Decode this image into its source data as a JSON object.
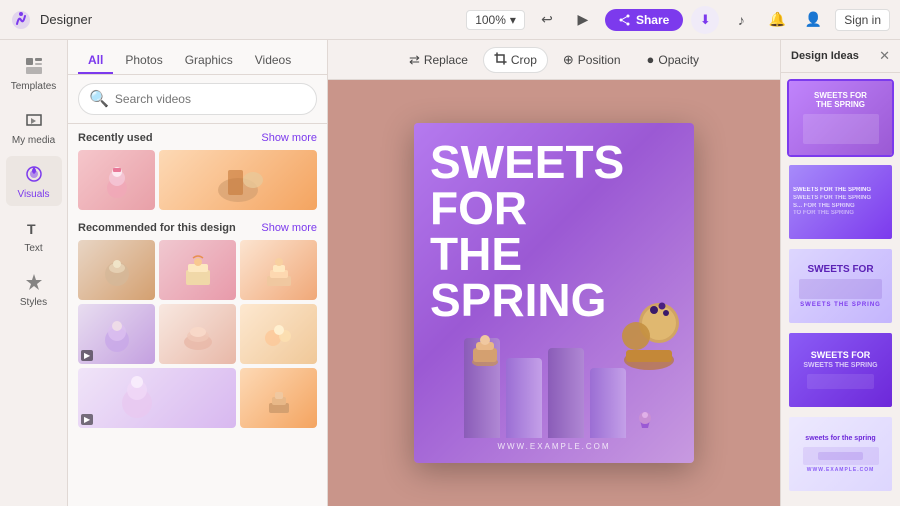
{
  "app": {
    "logo": "🎨",
    "name": "Designer"
  },
  "titlebar": {
    "zoom": "100%",
    "undo_icon": "↩",
    "redo_icon": "▶",
    "share_label": "Share",
    "download_icon": "⬇",
    "sound_icon": "🔔",
    "bell_icon": "🔔",
    "user_icon": "👤",
    "signin_label": "Sign in"
  },
  "icon_rail": {
    "items": [
      {
        "id": "templates",
        "label": "Templates",
        "icon": "⊞"
      },
      {
        "id": "my-media",
        "label": "My media",
        "icon": "📁"
      },
      {
        "id": "visuals",
        "label": "Visuals",
        "icon": "✦"
      },
      {
        "id": "text",
        "label": "Text",
        "icon": "T"
      },
      {
        "id": "styles",
        "label": "Styles",
        "icon": "♦"
      }
    ]
  },
  "left_panel": {
    "tabs": [
      {
        "id": "all",
        "label": "All"
      },
      {
        "id": "photos",
        "label": "Photos"
      },
      {
        "id": "graphics",
        "label": "Graphics"
      },
      {
        "id": "videos",
        "label": "Videos"
      }
    ],
    "search_placeholder": "Search videos",
    "recently_used_label": "Recently used",
    "show_more_label": "Show more",
    "recommended_label": "Recommended for this design",
    "recommended_show_more": "Show more"
  },
  "toolbar": {
    "replace_label": "Replace",
    "crop_label": "Crop",
    "position_label": "Position",
    "opacity_label": "Opacity",
    "replace_icon": "⇄",
    "crop_icon": "✂",
    "position_icon": "⊕",
    "opacity_icon": "●"
  },
  "canvas": {
    "headline": "SWEETS\nFOR\nTHE\nSPRING",
    "url": "WWW.EXAMPLE.COM"
  },
  "right_panel": {
    "title": "Design Ideas",
    "close_icon": "✕",
    "ideas": [
      {
        "id": 1,
        "label": "Sweets for\nthe spring",
        "class": "idea-1"
      },
      {
        "id": 2,
        "label": "Sweets for the spring",
        "class": "idea-2"
      },
      {
        "id": 3,
        "label": "SWEETS FOR",
        "class": "idea-3"
      },
      {
        "id": 4,
        "label": "SWEETS FOR\nTHE SPRING",
        "class": "idea-4"
      },
      {
        "id": 5,
        "label": "sweets for the spring",
        "class": "idea-5"
      }
    ]
  }
}
